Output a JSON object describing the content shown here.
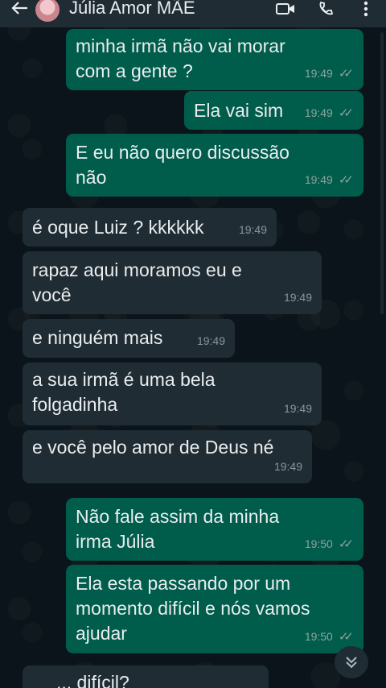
{
  "header": {
    "contact_name": "Júlia Amor MÃE"
  },
  "messages": [
    {
      "direction": "out",
      "text": "minha irmã não vai morar\ncom a gente ?",
      "time": "19:49",
      "status": "read"
    },
    {
      "direction": "out",
      "text": "Ela vai sim",
      "time": "19:49",
      "status": "read"
    },
    {
      "direction": "out",
      "text": "E eu não quero discussão\nnão",
      "time": "19:49",
      "status": "read"
    },
    {
      "direction": "in",
      "text": "é oque Luiz ? kkkkkk",
      "time": "19:49"
    },
    {
      "direction": "in",
      "text": "rapaz aqui moramos eu e\nvocê",
      "time": "19:49"
    },
    {
      "direction": "in",
      "text": "e ninguém mais",
      "time": "19:49"
    },
    {
      "direction": "in",
      "text": "a sua irmã é uma bela\nfolgadinha",
      "time": "19:49"
    },
    {
      "direction": "in",
      "text": "e você pelo amor de Deus né",
      "time": "19:49"
    },
    {
      "direction": "out",
      "text": "Não fale assim da minha\nirma Júlia",
      "time": "19:50",
      "status": "read"
    },
    {
      "direction": "out",
      "text": "Ela esta passando por um\nmomento difícil e nós vamos\najudar",
      "time": "19:50",
      "status": "read"
    },
    {
      "direction": "in",
      "text": "... difícil?",
      "time": ""
    }
  ],
  "colors": {
    "background": "#0b141a",
    "header": "#1f2c34",
    "outgoing_bubble": "#005c4b",
    "incoming_bubble": "#202c33"
  },
  "icons": {
    "back": "arrow-left-icon",
    "video": "video-call-icon",
    "call": "phone-icon",
    "menu": "more-vertical-icon",
    "scroll": "double-chevron-down-icon",
    "read": "double-check-icon"
  }
}
